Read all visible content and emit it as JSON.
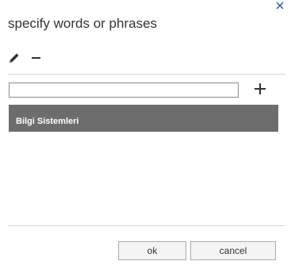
{
  "dialog": {
    "title": "specify words or phrases",
    "close_icon": "close-icon"
  },
  "toolbar": {
    "edit_icon": "pencil-icon",
    "remove_icon": "minus-icon"
  },
  "entry": {
    "value": "",
    "add_icon": "plus-icon"
  },
  "list": {
    "items": [
      {
        "label": "Bilgi Sistemleri",
        "selected": true
      }
    ]
  },
  "buttons": {
    "ok_label": "ok",
    "cancel_label": "cancel"
  },
  "colors": {
    "selected_row": "#6d6d6d",
    "close_icon": "#2b579a"
  }
}
